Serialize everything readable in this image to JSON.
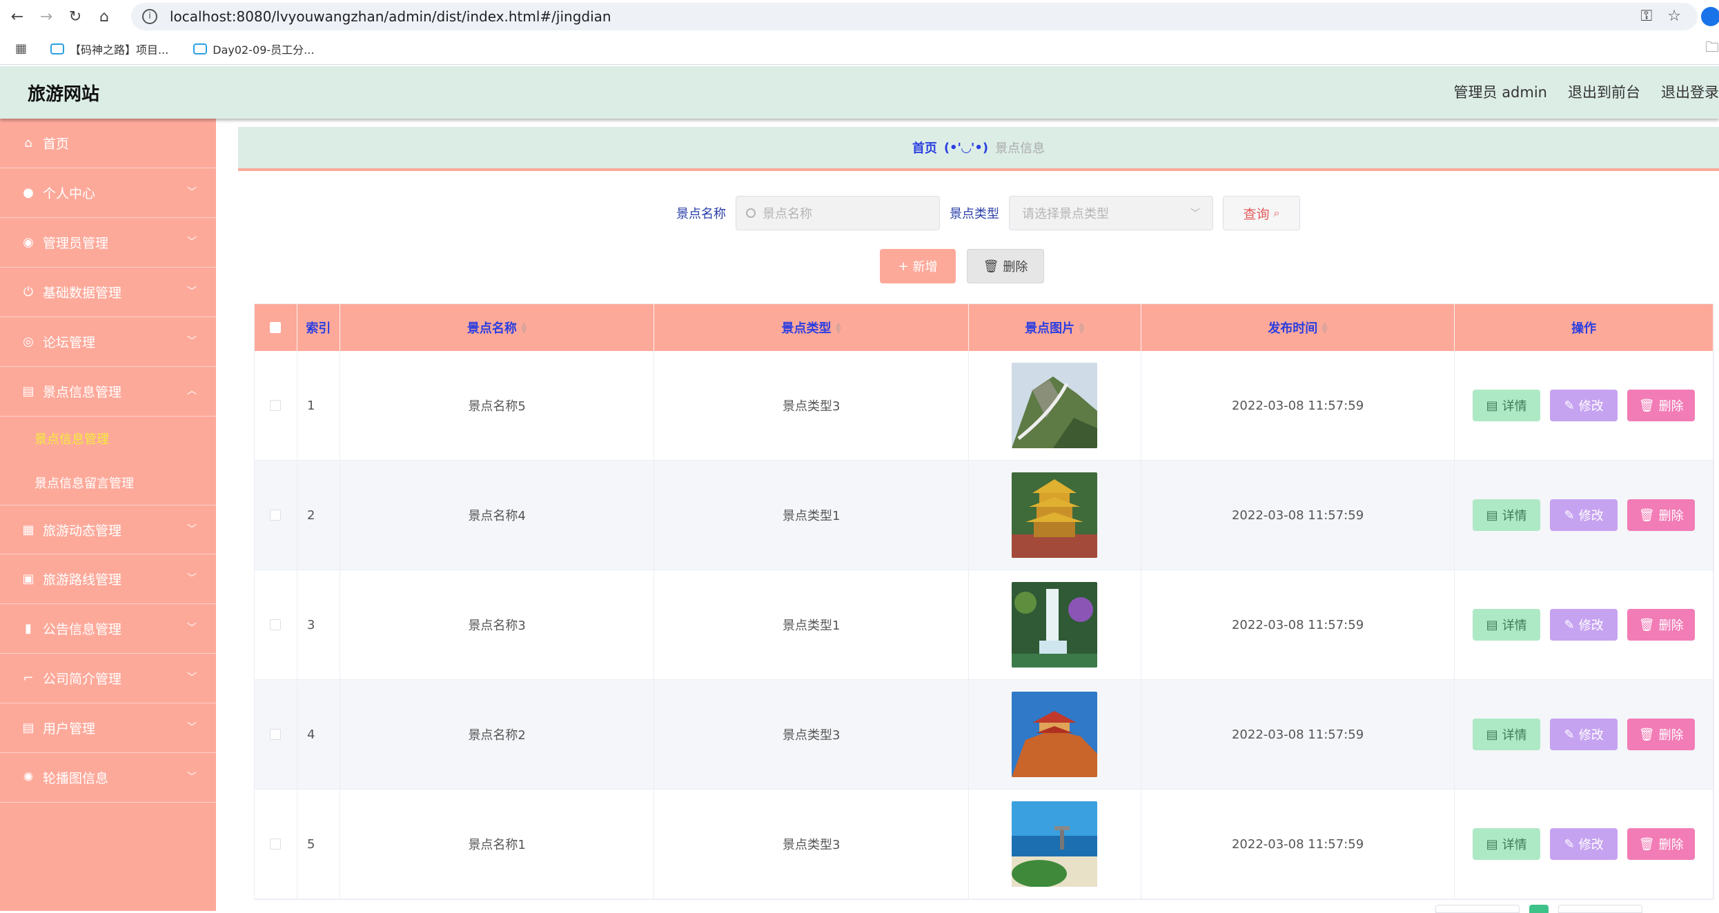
{
  "browser": {
    "url": "localhost:8080/lvyouwangzhan/admin/dist/index.html#/jingdian",
    "bookmarks": [
      "【码神之路】项目...",
      "Day02-09-员工分..."
    ]
  },
  "header": {
    "title": "旅游网站",
    "user": "管理员 admin",
    "to_front": "退出到前台",
    "logout": "退出登录"
  },
  "sidebar": {
    "items": [
      {
        "label": "首页",
        "icon": "home-icon"
      },
      {
        "label": "个人中心",
        "icon": "user-icon"
      },
      {
        "label": "管理员管理",
        "icon": "location-icon"
      },
      {
        "label": "基础数据管理",
        "icon": "power-icon"
      },
      {
        "label": "论坛管理",
        "icon": "compass-icon"
      },
      {
        "label": "景点信息管理",
        "icon": "clipboard-icon"
      },
      {
        "label": "旅游动态管理",
        "icon": "grid-icon"
      },
      {
        "label": "旅游路线管理",
        "icon": "briefcase-icon"
      },
      {
        "label": "公告信息管理",
        "icon": "bar-chart-icon"
      },
      {
        "label": "公司简介管理",
        "icon": "crop-icon"
      },
      {
        "label": "用户管理",
        "icon": "clipboard-check-icon"
      },
      {
        "label": "轮播图信息",
        "icon": "aperture-icon"
      }
    ],
    "sub_items": [
      "景点信息管理",
      "景点信息留言管理"
    ]
  },
  "breadcrumb": {
    "home": "首页",
    "separator": "(•'◡'•)",
    "current": "景点信息"
  },
  "search": {
    "name_label": "景点名称",
    "name_placeholder": "景点名称",
    "type_label": "景点类型",
    "type_placeholder": "请选择景点类型",
    "query_button": "查询"
  },
  "actions": {
    "add": "新增",
    "delete": "删除"
  },
  "table": {
    "columns": [
      "索引",
      "景点名称",
      "景点类型",
      "景点图片",
      "发布时间",
      "操作"
    ],
    "rows": [
      {
        "index": "1",
        "name": "景点名称5",
        "type": "景点类型3",
        "time": "2022-03-08 11:57:59"
      },
      {
        "index": "2",
        "name": "景点名称4",
        "type": "景点类型1",
        "time": "2022-03-08 11:57:59"
      },
      {
        "index": "3",
        "name": "景点名称3",
        "type": "景点类型1",
        "time": "2022-03-08 11:57:59"
      },
      {
        "index": "4",
        "name": "景点名称2",
        "type": "景点类型3",
        "time": "2022-03-08 11:57:59"
      },
      {
        "index": "5",
        "name": "景点名称1",
        "type": "景点类型3",
        "time": "2022-03-08 11:57:59"
      }
    ],
    "row_actions": {
      "detail": "详情",
      "edit": "修改",
      "remove": "删除"
    }
  },
  "colors": {
    "sidebar_bg": "#fda99a",
    "header_bg": "#dcede6",
    "accent_blue": "#2a3ee0",
    "active_sub": "#f4ec3c",
    "detail_btn": "#aee9c5",
    "edit_btn": "#c6a3f0",
    "remove_btn": "#f27cb6"
  }
}
